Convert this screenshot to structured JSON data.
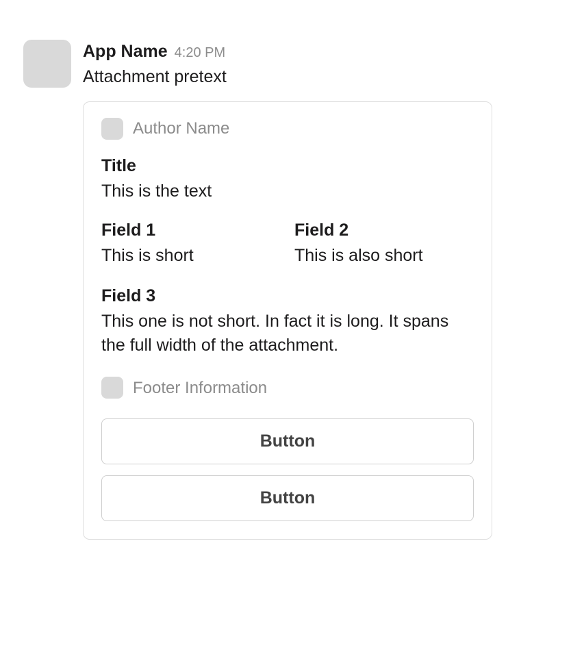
{
  "message": {
    "app_name": "App Name",
    "timestamp": "4:20 PM",
    "pretext": "Attachment pretext",
    "attachment": {
      "author_name": "Author Name",
      "title": "Title",
      "text": "This is the text",
      "fields": [
        {
          "title": "Field 1",
          "value": "This is short",
          "short": true
        },
        {
          "title": "Field 2",
          "value": "This is also short",
          "short": true
        },
        {
          "title": "Field 3",
          "value": "This one is not short. In fact it is long. It spans the full width of the attachment.",
          "short": false
        }
      ],
      "footer": "Footer Information",
      "buttons": [
        {
          "label": "Button"
        },
        {
          "label": "Button"
        }
      ]
    }
  }
}
